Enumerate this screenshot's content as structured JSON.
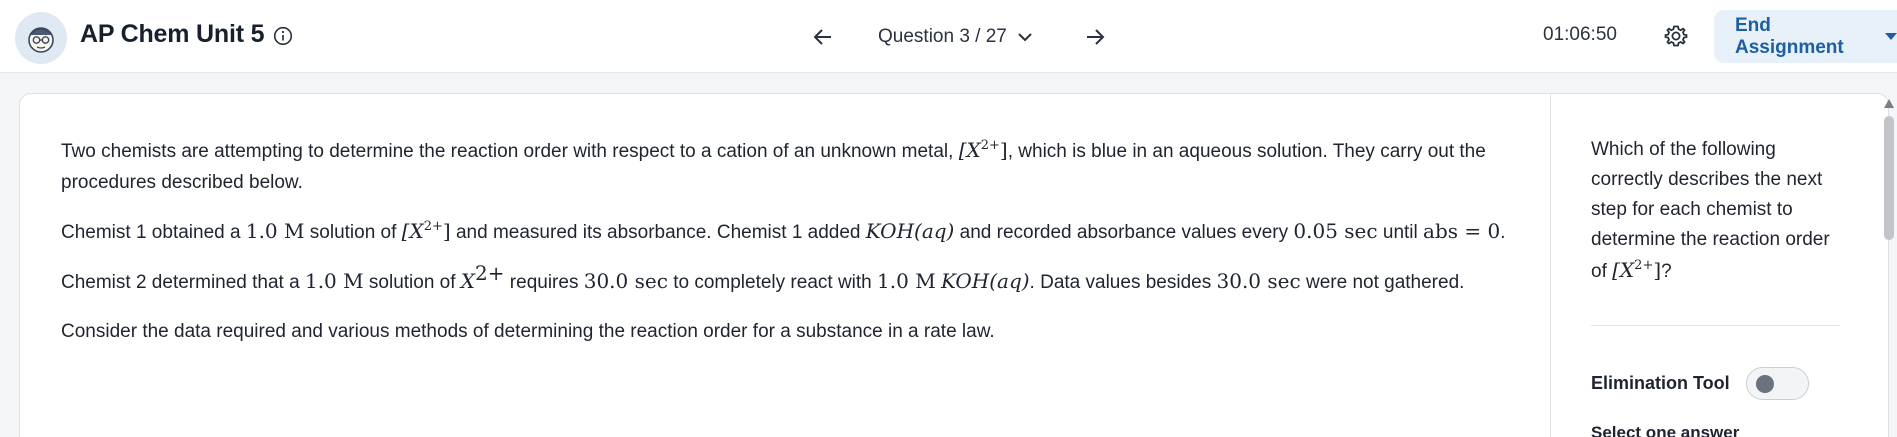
{
  "header": {
    "title": "AP Chem Unit 5",
    "question_selector": "Question 3 / 27",
    "timer": "01:06:50",
    "end_button": "End Assignment"
  },
  "passage": {
    "p1": {
      "a": "Two chemists are attempting to determine the reaction order with respect to a cation of an unknown metal, ",
      "ion_base": "[X",
      "ion_sup": "2+",
      "ion_close": "]",
      "b": ", which is blue in an aqueous solution. They carry out the procedures described below."
    },
    "p2": {
      "a": "Chemist 1 obtained a ",
      "conc": "1.0 M",
      "b": " solution of ",
      "ion_base": "[X",
      "ion_sup": "2+",
      "ion_close": "]",
      "c": " and measured its absorbance. Chemist 1 added ",
      "koh": "KOH(aq)",
      "d": " and recorded absorbance values every ",
      "interval": "0.05 sec",
      "e": " until ",
      "abs": "abs = 0",
      "f": "."
    },
    "p3": {
      "a": "Chemist 2 determined that a ",
      "conc": "1.0 M",
      "b": " solution of ",
      "ion_base": "X",
      "ion_sup": "2+",
      "c": " requires ",
      "time": "30.0 sec",
      "d": " to completely react with ",
      "conc2": "1.0 M",
      "koh": "KOH(aq)",
      "e": ". Data values besides ",
      "time2": "30.0 sec",
      "f": " were not gathered."
    },
    "p4": "Consider the data required and various methods of determining the reaction order for a substance in a rate law."
  },
  "question": {
    "a": "Which of the following correctly describes the next step for each chemist to determine the reaction order of ",
    "ion_base": "[X",
    "ion_sup": "2+",
    "ion_close": "]",
    "b": "?"
  },
  "sidebar": {
    "elimination_label": "Elimination Tool",
    "elimination_on": false,
    "select_prompt": "Select one answer"
  },
  "colors": {
    "accent": "#1b5fa8",
    "end_button_bg": "#e8f1fa"
  },
  "icons": [
    "mascot-avatar-icon",
    "info-icon",
    "arrow-left-icon",
    "chevron-down-icon",
    "arrow-right-icon",
    "gear-icon",
    "caret-down-icon"
  ]
}
